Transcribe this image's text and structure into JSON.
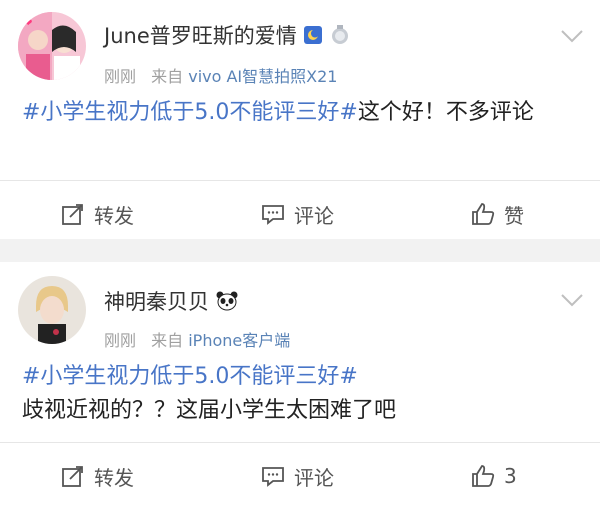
{
  "posts": [
    {
      "username": "June普罗旺斯的爱情",
      "time": "刚刚",
      "source_prefix": "来自",
      "source": "vivo AI智慧拍照X21",
      "hashtag": "#小学生视力低于5.0不能评三好#",
      "text": "这个好！不多评论",
      "actions": {
        "repost": "转发",
        "comment": "评论",
        "like": "赞"
      },
      "icons": [
        "avatar-photo",
        "vip-badge-icon",
        "silver-medal-icon",
        "chevron-down-icon",
        "repost-icon",
        "comment-icon",
        "thumbs-up-icon"
      ]
    },
    {
      "username": "神明秦贝贝",
      "time": "刚刚",
      "source_prefix": "来自",
      "source": "iPhone客户端",
      "hashtag": "#小学生视力低于5.0不能评三好#",
      "text": "歧视近视的？？这届小学生太困难了吧",
      "actions": {
        "repost": "转发",
        "comment": "评论",
        "like": "3"
      },
      "icons": [
        "avatar-photo",
        "panda-icon",
        "chevron-down-icon",
        "repost-icon",
        "comment-icon",
        "thumbs-up-icon"
      ]
    }
  ],
  "colors": {
    "link": "#4875c7",
    "meta": "#a0a0a0",
    "source": "#5a83b6",
    "background": "#f2f2f2"
  }
}
